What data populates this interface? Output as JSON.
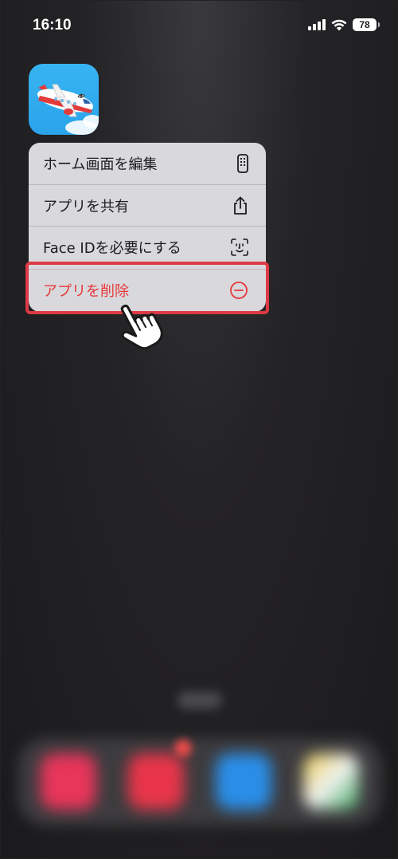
{
  "status_bar": {
    "time": "16:10",
    "battery": "78",
    "signal_icon": "cellular-signal-icon",
    "wifi_icon": "wifi-icon"
  },
  "app_icon": {
    "name": "airplane-app-icon"
  },
  "context_menu": {
    "items": [
      {
        "label": "ホーム画面を編集",
        "icon": "phone-icon"
      },
      {
        "label": "アプリを共有",
        "icon": "share-icon"
      },
      {
        "label": "Face IDを必要にする",
        "icon": "face-id-icon"
      },
      {
        "label": "アプリを削除",
        "icon": "minus-circle-icon",
        "destructive": true
      }
    ]
  },
  "colors": {
    "destructive": "#e6393a",
    "highlight_border": "#dd3a45",
    "menu_background": "#d9d8dc"
  }
}
